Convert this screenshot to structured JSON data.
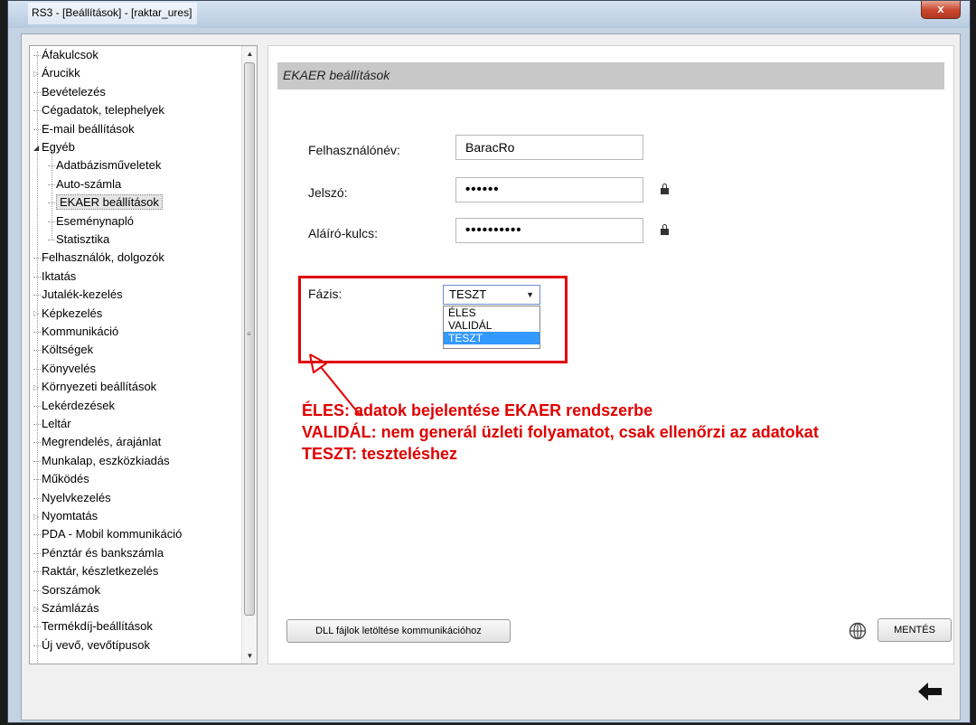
{
  "window": {
    "title": "RS3 - [Beállítások] - [raktar_ures]",
    "close_label": "x"
  },
  "tree": {
    "items": [
      {
        "label": "Áfakulcsok",
        "level": 0,
        "expander": "none"
      },
      {
        "label": "Árucikk",
        "level": 0,
        "expander": "collapsed"
      },
      {
        "label": "Bevételezés",
        "level": 0,
        "expander": "none"
      },
      {
        "label": "Cégadatok, telephelyek",
        "level": 0,
        "expander": "none"
      },
      {
        "label": "E-mail beállítások",
        "level": 0,
        "expander": "none"
      },
      {
        "label": "Egyéb",
        "level": 0,
        "expander": "expanded"
      },
      {
        "label": "Adatbázisműveletek",
        "level": 1,
        "expander": "none"
      },
      {
        "label": "Auto-számla",
        "level": 1,
        "expander": "none"
      },
      {
        "label": "EKAER beállítások",
        "level": 1,
        "expander": "none",
        "selected": true
      },
      {
        "label": "Eseménynapló",
        "level": 1,
        "expander": "none"
      },
      {
        "label": "Statisztika",
        "level": 1,
        "expander": "none"
      },
      {
        "label": "Felhasználók, dolgozók",
        "level": 0,
        "expander": "none"
      },
      {
        "label": "Iktatás",
        "level": 0,
        "expander": "none"
      },
      {
        "label": "Jutalék-kezelés",
        "level": 0,
        "expander": "none"
      },
      {
        "label": "Képkezelés",
        "level": 0,
        "expander": "collapsed"
      },
      {
        "label": "Kommunikáció",
        "level": 0,
        "expander": "none"
      },
      {
        "label": "Költségek",
        "level": 0,
        "expander": "none"
      },
      {
        "label": "Könyvelés",
        "level": 0,
        "expander": "none"
      },
      {
        "label": "Környezeti beállítások",
        "level": 0,
        "expander": "collapsed"
      },
      {
        "label": "Lekérdezések",
        "level": 0,
        "expander": "none"
      },
      {
        "label": "Leltár",
        "level": 0,
        "expander": "none"
      },
      {
        "label": "Megrendelés, árajánlat",
        "level": 0,
        "expander": "none"
      },
      {
        "label": "Munkalap, eszközkiadás",
        "level": 0,
        "expander": "none"
      },
      {
        "label": "Működés",
        "level": 0,
        "expander": "none"
      },
      {
        "label": "Nyelvkezelés",
        "level": 0,
        "expander": "none"
      },
      {
        "label": "Nyomtatás",
        "level": 0,
        "expander": "collapsed"
      },
      {
        "label": "PDA - Mobil kommunikáció",
        "level": 0,
        "expander": "none"
      },
      {
        "label": "Pénztár és bankszámla",
        "level": 0,
        "expander": "none"
      },
      {
        "label": "Raktár, készletkezelés",
        "level": 0,
        "expander": "none"
      },
      {
        "label": "Sorszámok",
        "level": 0,
        "expander": "none"
      },
      {
        "label": "Számlázás",
        "level": 0,
        "expander": "collapsed"
      },
      {
        "label": "Termékdíj-beállítások",
        "level": 0,
        "expander": "none"
      },
      {
        "label": "Új vevő, vevőtípusok",
        "level": 0,
        "expander": "none"
      }
    ]
  },
  "panel": {
    "title": "EKAER beállítások",
    "username_label": "Felhasználónév:",
    "username_value": "BaracRo",
    "password_label": "Jelszó:",
    "password_value": "••••••",
    "signing_key_label": "Aláíró-kulcs:",
    "signing_key_value": "••••••••••",
    "phase_label": "Fázis:",
    "phase_selected": "TESZT",
    "phase_options": [
      "ÉLES",
      "VALIDÁL",
      "TESZT"
    ]
  },
  "annotation": {
    "lines": [
      "ÉLES: adatok bejelentése EKAER rendszerbe",
      "VALIDÁL: nem generál üzleti folyamatot, csak ellenőrzi az adatokat",
      "TESZT: teszteléshez"
    ],
    "color": "#e00000"
  },
  "buttons": {
    "dll_download": "DLL fájlok letöltése kommunikációhoz",
    "save": "MENTÉS"
  },
  "icons": {
    "lock": "lock-icon",
    "globe": "globe-icon",
    "back": "back-arrow-icon"
  }
}
